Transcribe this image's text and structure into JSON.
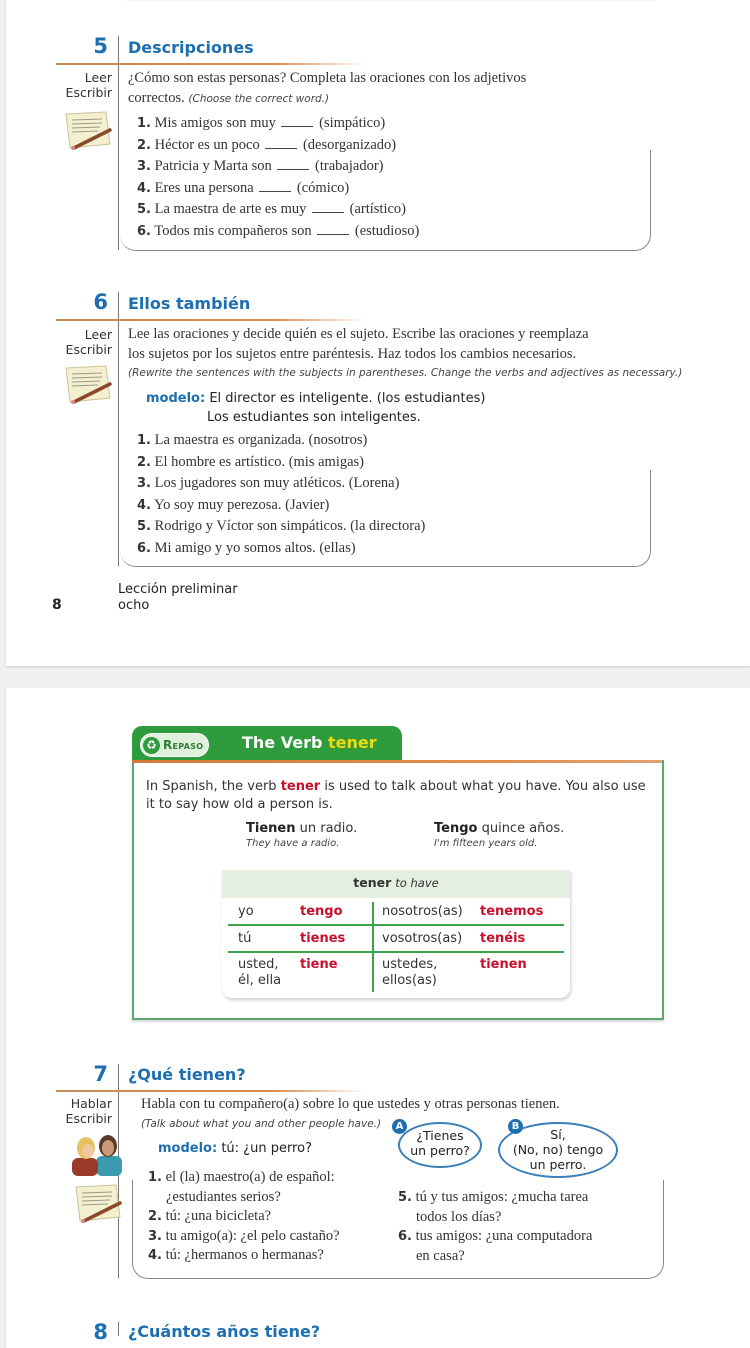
{
  "page1": {
    "activity5": {
      "number": "5",
      "title": "Descripciones",
      "skills": [
        "Leer",
        "Escribir"
      ],
      "instructions_es": "¿Cómo son estas personas? Completa las oraciones con los adjetivos",
      "instructions_es_2": "correctos.",
      "instructions_en": "(Choose the correct word.)",
      "items": [
        {
          "n": "1.",
          "pre": "Mis amigos son muy",
          "hint": "(simpático)"
        },
        {
          "n": "2.",
          "pre": "Héctor es un poco",
          "hint": "(desorganizado)"
        },
        {
          "n": "3.",
          "pre": "Patricia y Marta son",
          "hint": "(trabajador)"
        },
        {
          "n": "4.",
          "pre": "Eres una persona",
          "hint": "(cómico)"
        },
        {
          "n": "5.",
          "pre": "La maestra de arte es muy",
          "hint": "(artístico)"
        },
        {
          "n": "6.",
          "pre": "Todos mis compañeros son",
          "hint": "(estudioso)"
        }
      ]
    },
    "activity6": {
      "number": "6",
      "title": "Ellos también",
      "skills": [
        "Leer",
        "Escribir"
      ],
      "instructions_es_1": "Lee las oraciones y decide quién es el sujeto. Escribe las oraciones y reemplaza",
      "instructions_es_2": "los sujetos por los sujetos entre paréntesis. Haz todos los cambios necesarios.",
      "instructions_en": "(Rewrite the sentences with the subjects in parentheses. Change the verbs and adjectives as necessary.)",
      "modelo_label": "modelo:",
      "modelo_line1": "El director es inteligente. (los estudiantes)",
      "modelo_line2": "Los estudiantes son inteligentes.",
      "items": [
        {
          "n": "1.",
          "text": "La maestra es organizada. (nosotros)"
        },
        {
          "n": "2.",
          "text": "El hombre es artístico. (mis amigas)"
        },
        {
          "n": "3.",
          "text": "Los jugadores son muy atléticos. (Lorena)"
        },
        {
          "n": "4.",
          "text": "Yo soy muy perezosa. (Javier)"
        },
        {
          "n": "5.",
          "text": "Rodrigo y Víctor son simpáticos. (la directora)"
        },
        {
          "n": "6.",
          "text": "Mi amigo y yo somos altos. (ellas)"
        }
      ]
    },
    "footer": {
      "page_number": "8",
      "lesson": "Lección preliminar",
      "page_word": "ocho"
    }
  },
  "page2": {
    "repaso": {
      "badge": "Repaso",
      "badge_icon": "recycle-icon",
      "title_prefix": "The Verb",
      "title_verb": "tener",
      "text_1": "In Spanish, the verb",
      "text_verb": "tener",
      "text_2": "is used to talk about what you have. You also use it to say how old a person is.",
      "examples": [
        {
          "bold": "Tienen",
          "rest": "un radio.",
          "translation": "They have a radio."
        },
        {
          "bold": "Tengo",
          "rest": "quince años.",
          "translation": "I'm fifteen years old."
        }
      ],
      "table": {
        "verb": "tener",
        "meaning": "to have",
        "rows": [
          {
            "p1": "yo",
            "f1": "tengo",
            "p2": "nosotros(as)",
            "f2": "tenemos"
          },
          {
            "p1": "tú",
            "f1": "tienes",
            "p2": "vosotros(as)",
            "f2": "tenéis"
          },
          {
            "p1": "usted,\nél, ella",
            "f1": "tiene",
            "p2": "ustedes,\nellos(as)",
            "f2": "tienen"
          }
        ]
      }
    },
    "activity7": {
      "number": "7",
      "title": "¿Qué tienen?",
      "skills": [
        "Hablar",
        "Escribir"
      ],
      "instructions_es": "Habla con tu compañero(a) sobre lo que ustedes y otras personas tienen.",
      "instructions_en": "(Talk about what you and other people have.)",
      "modelo_label": "modelo:",
      "modelo_text": "tú: ¿un perro?",
      "bubble_a": {
        "badge": "A",
        "line1": "¿Tienes",
        "line2": "un perro?"
      },
      "bubble_b": {
        "badge": "B",
        "line1": "Sí,",
        "line2": "(No, no) tengo",
        "line3": "un perro."
      },
      "items_left": [
        {
          "n": "1.",
          "line1": "el (la) maestro(a) de español:",
          "line2": "¿estudiantes serios?"
        },
        {
          "n": "2.",
          "line1": "tú: ¿una bicicleta?"
        },
        {
          "n": "3.",
          "line1": "tu amigo(a): ¿el pelo castaño?"
        },
        {
          "n": "4.",
          "line1": "tú: ¿hermanos o hermanas?"
        }
      ],
      "items_right": [
        {
          "n": "5.",
          "line1": "tú y tus amigos: ¿mucha tarea",
          "line2": "todos los días?"
        },
        {
          "n": "6.",
          "line1": "tus amigos: ¿una computadora",
          "line2": "en casa?"
        }
      ]
    },
    "activity8": {
      "number": "8",
      "title": "¿Cuántos años tiene?"
    }
  }
}
